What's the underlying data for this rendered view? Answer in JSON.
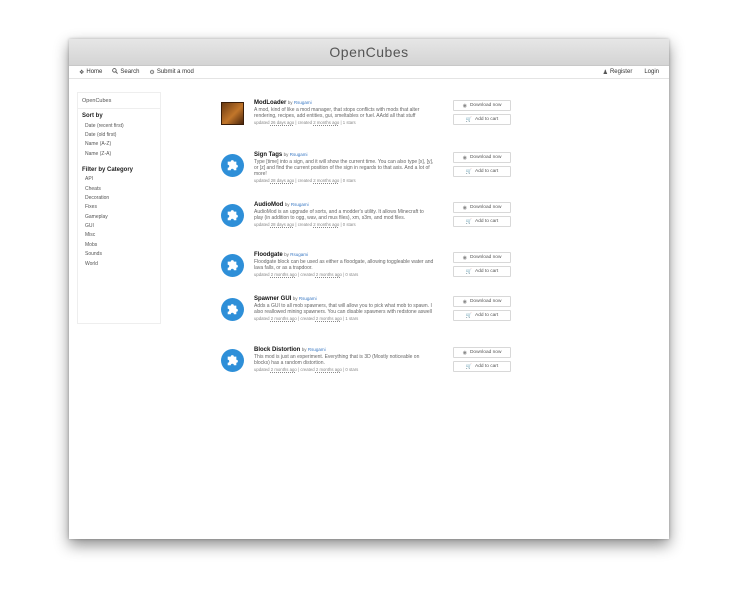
{
  "window": {
    "title": "OpenCubes"
  },
  "nav": {
    "home": "Home",
    "search": "Search",
    "submit": "Submit a mod",
    "register": "Register",
    "login": "Login"
  },
  "sidebar": {
    "brand": "OpenCubes",
    "sort_heading": "Sort by",
    "sort_items": [
      "Date (recent first)",
      "Date (old first)",
      "Name (A-Z)",
      "Name (Z-A)"
    ],
    "filter_heading": "Filter by Category",
    "categories": [
      "API",
      "Cheats",
      "Decoration",
      "Fixes",
      "Gameplay",
      "GUI",
      "Misc",
      "Mobs",
      "Sounds",
      "World"
    ]
  },
  "mods": [
    {
      "title": "ModLoader",
      "by": "by",
      "author": "Rsugami",
      "description": "A mod, kind of like a mod manager, that stops conflicts with mods that alter rendering, recipes, add entities, gui, smeltables or fuel. AAdd all that stuff",
      "updated_label": "updated",
      "updated": "26 days ago",
      "created_label": "created",
      "created": "2 months ago",
      "stars": "1 stars",
      "icon": "modloader-logo"
    },
    {
      "title": "Sign Tags",
      "by": "by",
      "author": "Rsugami",
      "description": "Type [time] into a sign, and it will show the current time. You can also type [x], [y], or [z] and find the current position of the sign in regards to that axis. And a lot of more!",
      "updated_label": "updated",
      "updated": "28 days ago",
      "created_label": "created",
      "created": "2 months ago",
      "stars": "0 stars",
      "icon": "puzzle-icon"
    },
    {
      "title": "AudioMod",
      "by": "by",
      "author": "Rsugami",
      "description": "AudioMod is an upgrade of sorts, and a modder's utility. It allows Minecraft to play (in addition to ogg, wav, and mus files), xm, s3m, and mod files.",
      "updated_label": "updated",
      "updated": "28 days ago",
      "created_label": "created",
      "created": "2 months ago",
      "stars": "0 stars",
      "icon": "puzzle-icon"
    },
    {
      "title": "Floodgate",
      "by": "by",
      "author": "Rsugami",
      "description": "Floodgate block can be used as either a floodgate, allowing toggleable water and lava falls, or as a trapdoor.",
      "updated_label": "updated",
      "updated": "2 months ago",
      "created_label": "created",
      "created": "2 months ago",
      "stars": "0 stars",
      "icon": "puzzle-icon"
    },
    {
      "title": "Spawner GUI",
      "by": "by",
      "author": "Rsugami",
      "description": "Adds a GUI to all mob spawners, that will allow you to pick what mob to spawn. I also reallowed mining spawners. You can disable spawners with redstone aswell",
      "updated_label": "updated",
      "updated": "2 months ago",
      "created_label": "created",
      "created": "2 months ago",
      "stars": "1 stars",
      "icon": "puzzle-icon"
    },
    {
      "title": "Block Distortion",
      "by": "by",
      "author": "Rsugami",
      "description": "This mod is just an experiment. Everything that is 3D (Mostly noticeable on blocks) has a random distortion.",
      "updated_label": "updated",
      "updated": "2 months ago",
      "created_label": "created",
      "created": "2 months ago",
      "stars": "0 stars",
      "icon": "puzzle-icon"
    }
  ],
  "buttons": {
    "download": "Download now",
    "cart": "Add to cart"
  },
  "colors": {
    "accent": "#3a79c4",
    "puzzle_bg": "#2e8fd8"
  }
}
